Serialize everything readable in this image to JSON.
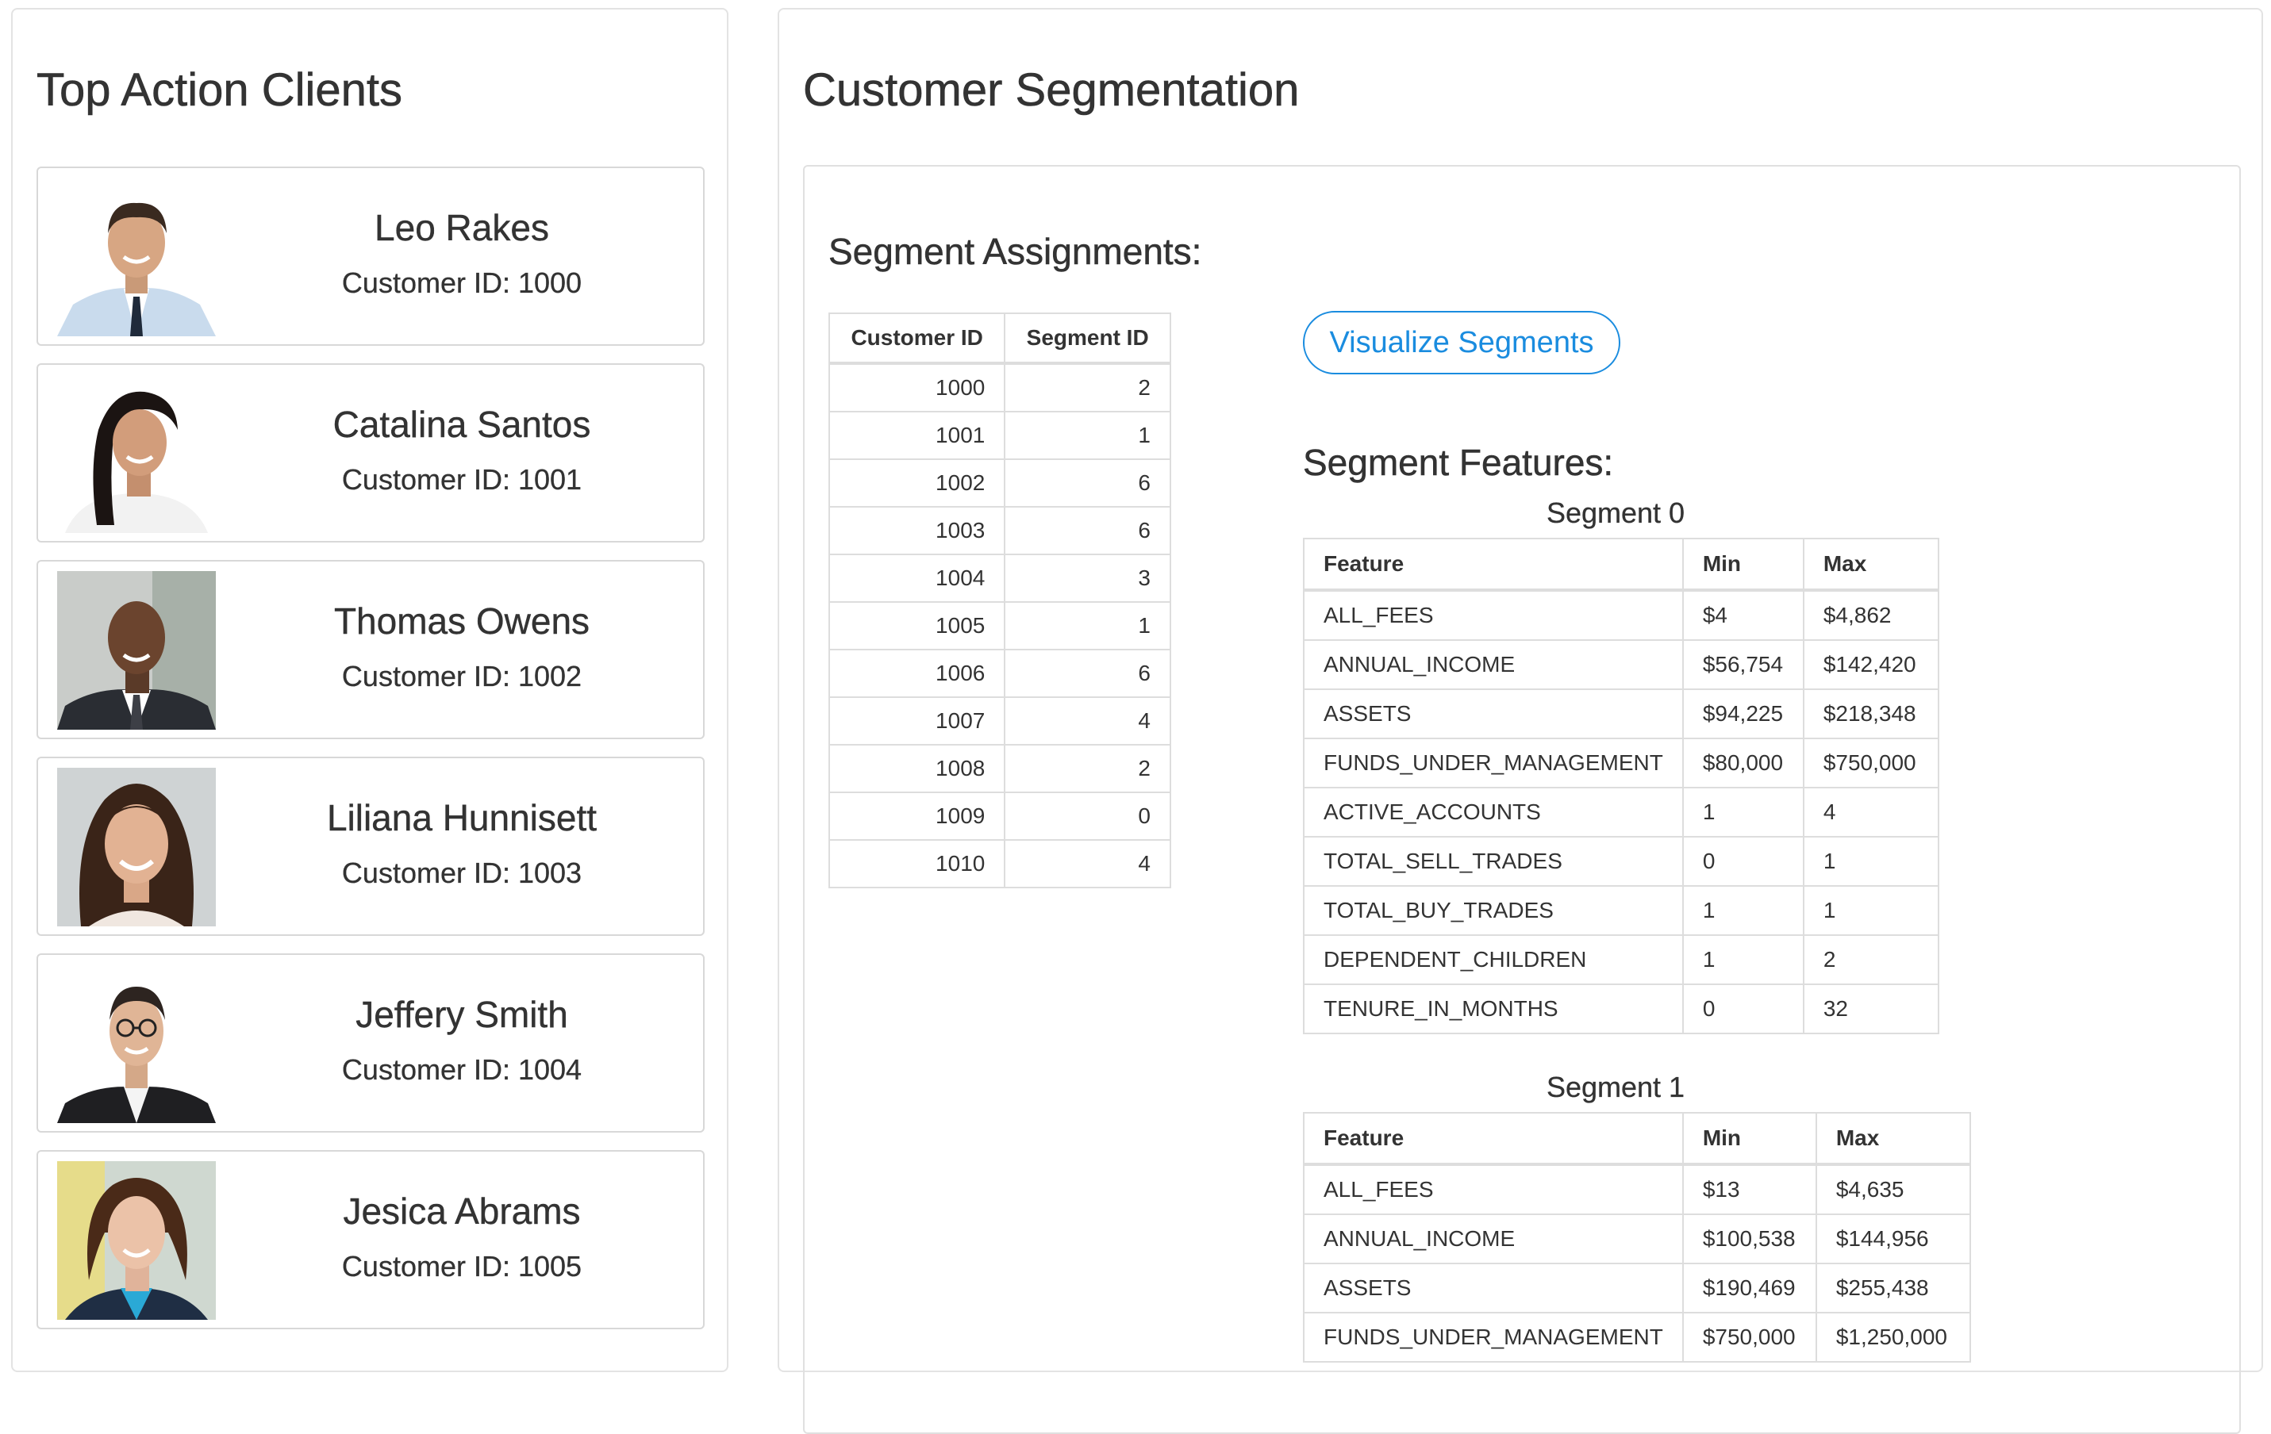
{
  "top_clients": {
    "title": "Top Action Clients",
    "clients": [
      {
        "name": "Leo Rakes",
        "id_line": "Customer ID: 1000"
      },
      {
        "name": "Catalina Santos",
        "id_line": "Customer ID: 1001"
      },
      {
        "name": "Thomas Owens",
        "id_line": "Customer ID: 1002"
      },
      {
        "name": "Liliana Hunnisett",
        "id_line": "Customer ID: 1003"
      },
      {
        "name": "Jeffery Smith",
        "id_line": "Customer ID: 1004"
      },
      {
        "name": "Jesica Abrams",
        "id_line": "Customer ID: 1005"
      }
    ]
  },
  "segmentation": {
    "title": "Customer Segmentation",
    "assignments_title": "Segment Assignments:",
    "assignments_headers": [
      "Customer ID",
      "Segment ID"
    ],
    "assignments": [
      [
        "1000",
        "2"
      ],
      [
        "1001",
        "1"
      ],
      [
        "1002",
        "6"
      ],
      [
        "1003",
        "6"
      ],
      [
        "1004",
        "3"
      ],
      [
        "1005",
        "1"
      ],
      [
        "1006",
        "6"
      ],
      [
        "1007",
        "4"
      ],
      [
        "1008",
        "2"
      ],
      [
        "1009",
        "0"
      ],
      [
        "1010",
        "4"
      ]
    ],
    "visualize_label": "Visualize Segments",
    "features_title": "Segment Features:",
    "feature_headers": [
      "Feature",
      "Min",
      "Max"
    ],
    "segments": [
      {
        "caption": "Segment 0",
        "rows": [
          [
            "ALL_FEES",
            "$4",
            "$4,862"
          ],
          [
            "ANNUAL_INCOME",
            "$56,754",
            "$142,420"
          ],
          [
            "ASSETS",
            "$94,225",
            "$218,348"
          ],
          [
            "FUNDS_UNDER_MANAGEMENT",
            "$80,000",
            "$750,000"
          ],
          [
            "ACTIVE_ACCOUNTS",
            "1",
            "4"
          ],
          [
            "TOTAL_SELL_TRADES",
            "0",
            "1"
          ],
          [
            "TOTAL_BUY_TRADES",
            "1",
            "1"
          ],
          [
            "DEPENDENT_CHILDREN",
            "1",
            "2"
          ],
          [
            "TENURE_IN_MONTHS",
            "0",
            "32"
          ]
        ]
      },
      {
        "caption": "Segment 1",
        "rows": [
          [
            "ALL_FEES",
            "$13",
            "$4,635"
          ],
          [
            "ANNUAL_INCOME",
            "$100,538",
            "$144,956"
          ],
          [
            "ASSETS",
            "$190,469",
            "$255,438"
          ],
          [
            "FUNDS_UNDER_MANAGEMENT",
            "$750,000",
            "$1,250,000"
          ]
        ]
      }
    ]
  },
  "colors": {
    "accent": "#1a8cdf",
    "border": "#dddddd",
    "text": "#333333"
  }
}
